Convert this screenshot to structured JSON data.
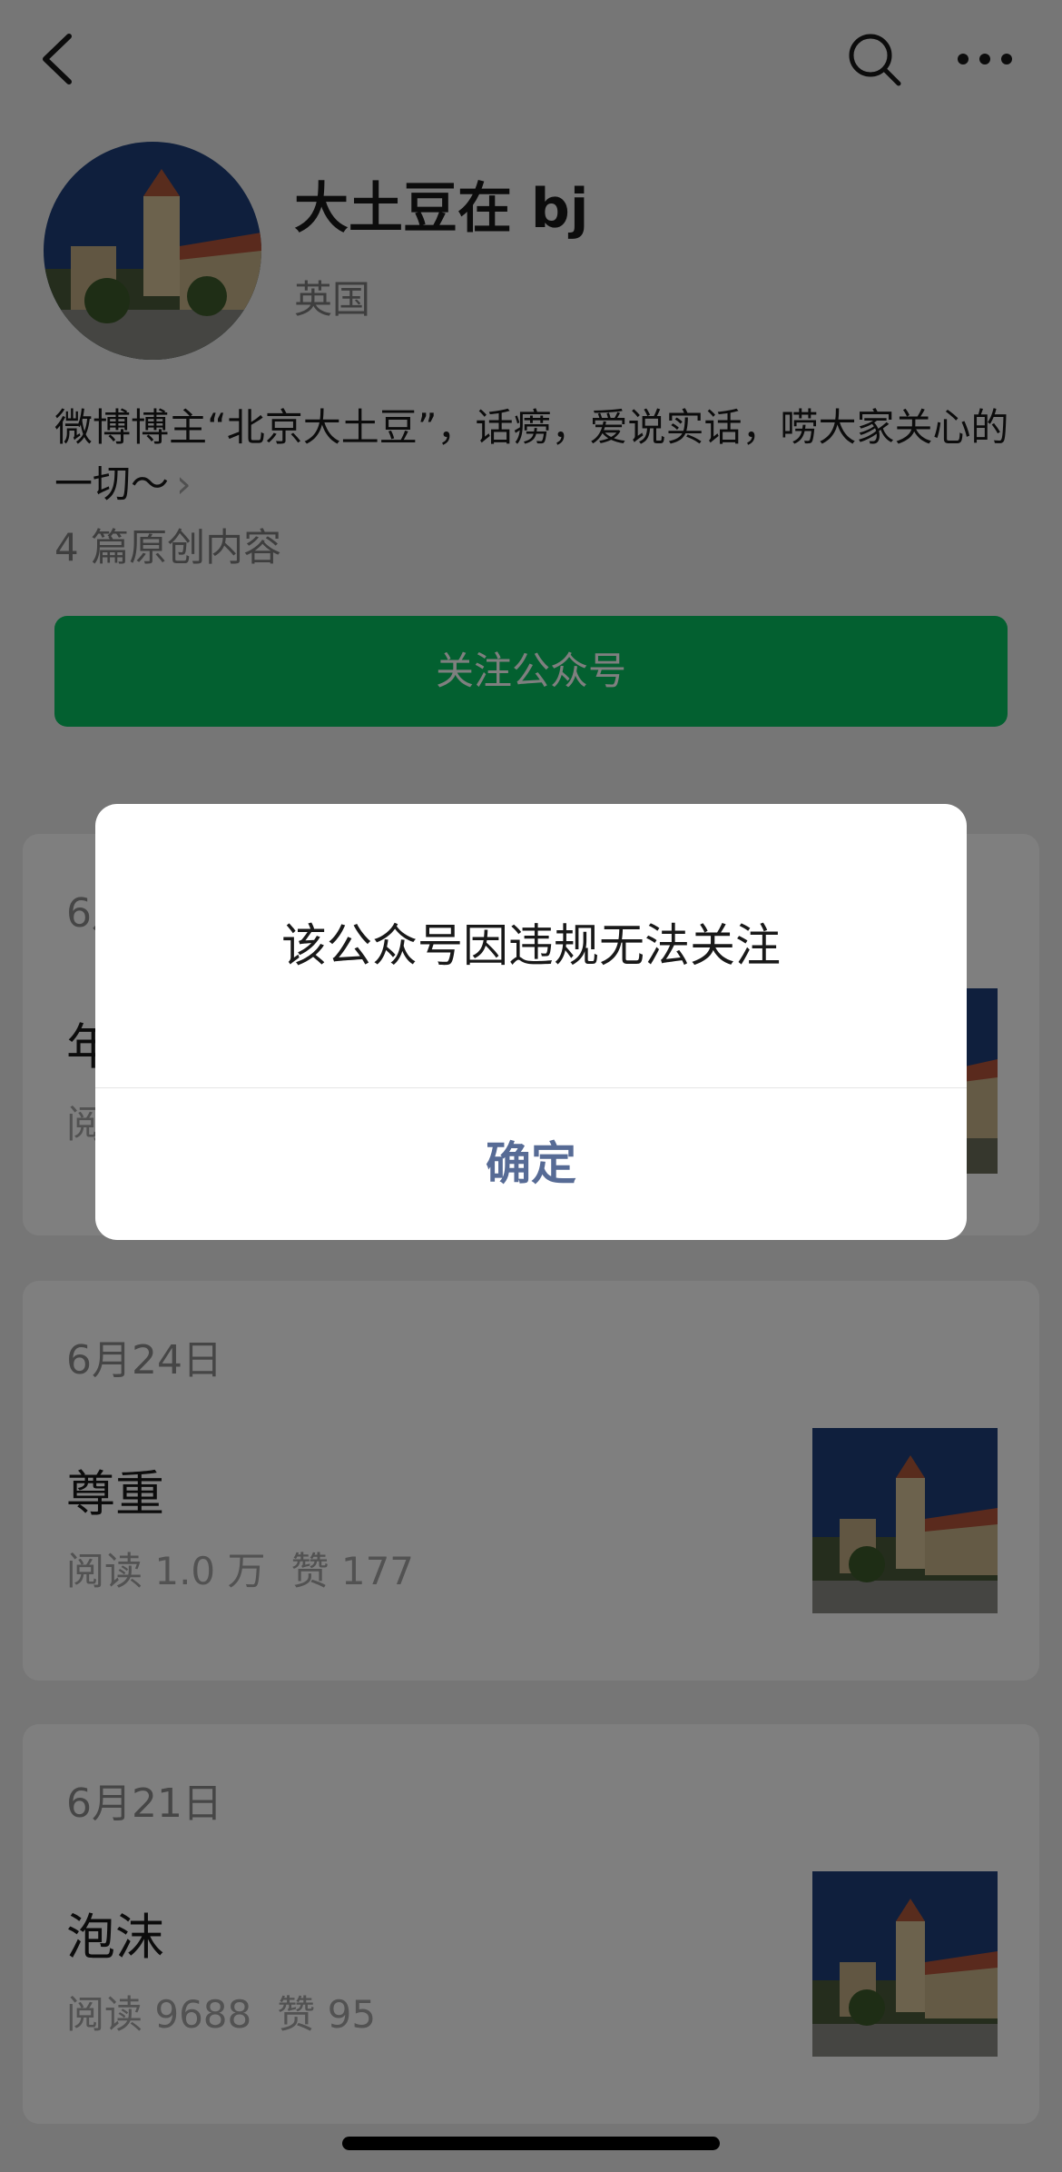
{
  "profile": {
    "name": "大土豆在 bj",
    "region": "英国",
    "description": "微博博主“北京大土豆”，话痨，爱说实话，唠大家关心的一切～",
    "description_arrow": "›",
    "articles": "4 篇原创内容",
    "follow_label": "关注公众号"
  },
  "posts": [
    {
      "date": "6月",
      "title": "年",
      "stats_read": "阅",
      "stats_like": ""
    },
    {
      "date": "6月24日",
      "title": "尊重",
      "stats_read": "阅读 1.0 万",
      "stats_like": "赞 177"
    },
    {
      "date": "6月21日",
      "title": "泡沫",
      "stats_read": "阅读 9688",
      "stats_like": "赞 95"
    }
  ],
  "dialog": {
    "message": "该公众号因违规无法关注",
    "confirm_label": "确定"
  },
  "colors": {
    "accent_green": "#07c160",
    "dialog_link_blue": "#576b95"
  },
  "icons": [
    "back-icon",
    "search-icon",
    "more-icon",
    "chevron-right-icon"
  ]
}
